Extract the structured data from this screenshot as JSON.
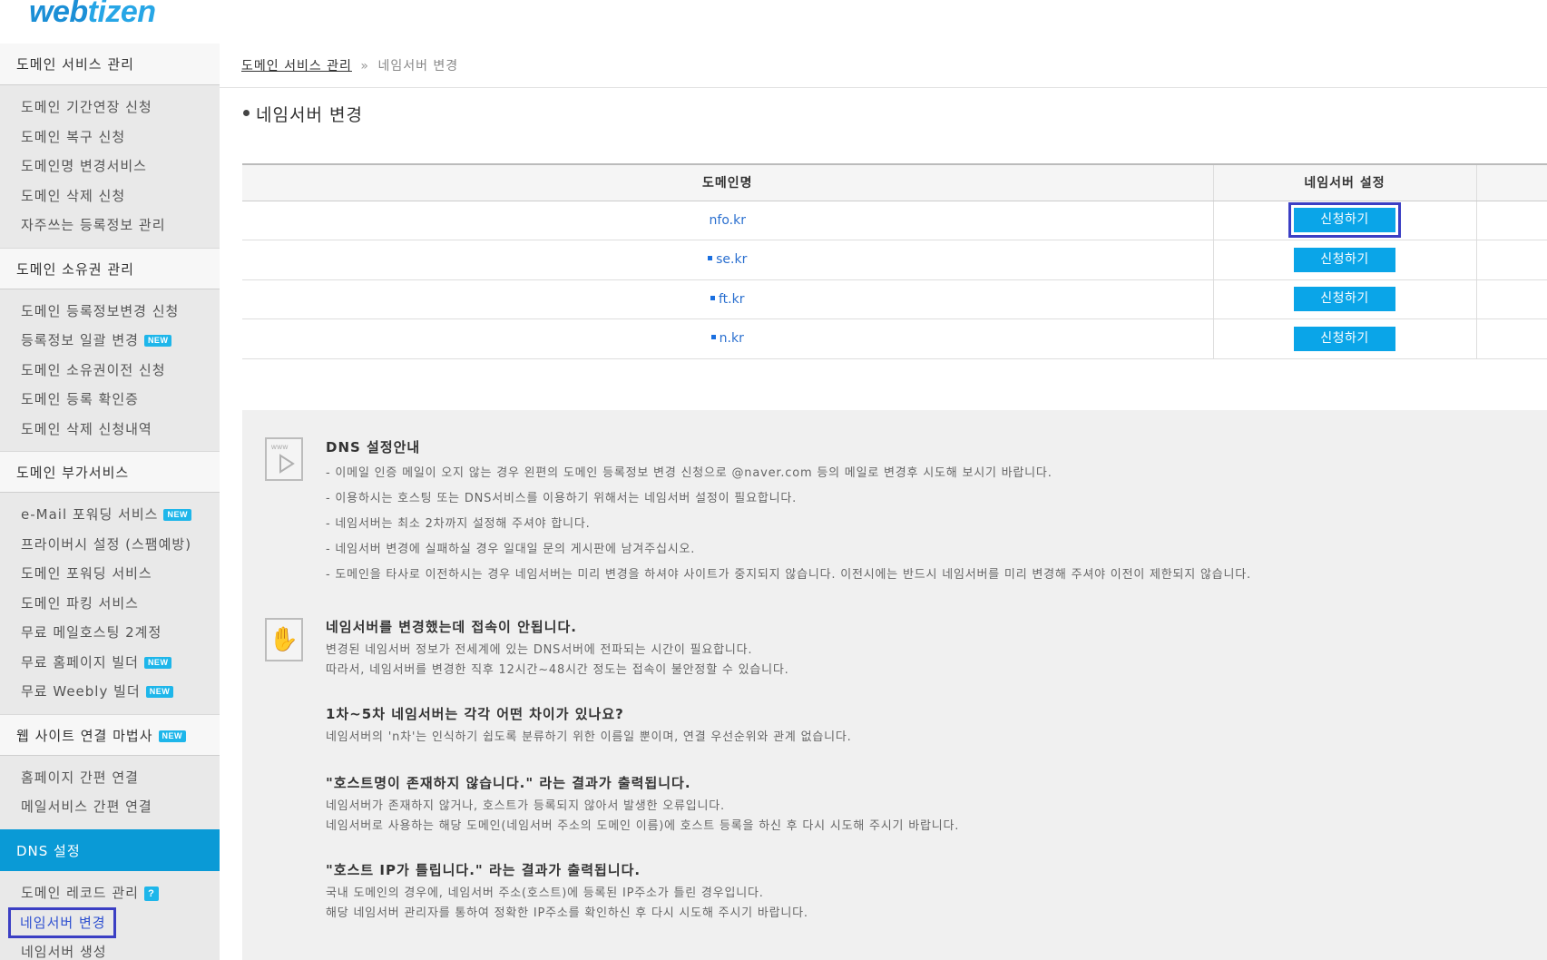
{
  "logo": {
    "part1": "web",
    "part2": "tizen"
  },
  "sidebar": {
    "sections": [
      {
        "title": "도메인 서비스 관리",
        "items": [
          {
            "label": "도메인 기간연장 신청"
          },
          {
            "label": "도메인 복구 신청"
          },
          {
            "label": "도메인명 변경서비스"
          },
          {
            "label": "도메인 삭제 신청"
          },
          {
            "label": "자주쓰는 등록정보 관리"
          }
        ]
      },
      {
        "title": "도메인 소유권 관리",
        "items": [
          {
            "label": "도메인 등록정보변경 신청"
          },
          {
            "label": "등록정보 일괄 변경",
            "badge": "NEW"
          },
          {
            "label": "도메인 소유권이전 신청"
          },
          {
            "label": "도메인 등록 확인증"
          },
          {
            "label": "도메인 삭제 신청내역"
          }
        ]
      },
      {
        "title": "도메인 부가서비스",
        "items": [
          {
            "label": "e-Mail 포워딩 서비스",
            "badge": "NEW"
          },
          {
            "label": "프라이버시 설정 (스팸예방)"
          },
          {
            "label": "도메인 포워딩 서비스"
          },
          {
            "label": "도메인 파킹 서비스"
          },
          {
            "label": "무료 메일호스팅 2계정"
          },
          {
            "label": "무료 홈페이지 빌더",
            "badge": "NEW"
          },
          {
            "label": "무료 Weebly 빌더",
            "badge": "NEW"
          }
        ]
      },
      {
        "title": "웹 사이트 연결 마법사",
        "badge": "NEW",
        "items": [
          {
            "label": "홈페이지 간편 연결"
          },
          {
            "label": "메일서비스 간편 연결"
          }
        ]
      },
      {
        "title": "DNS 설정",
        "items": [
          {
            "label": "도메인 레코드 관리",
            "badge": "?"
          },
          {
            "label": "네임서버 변경"
          },
          {
            "label": "네임서버 생성"
          }
        ]
      }
    ]
  },
  "breadcrumb": {
    "parent": "도메인 서비스 관리",
    "separator": "»",
    "current": "네임서버 변경"
  },
  "page_title": "네임서버 변경",
  "table": {
    "headers": {
      "domain": "도메인명",
      "nameserver": "네임서버 설정"
    },
    "rows": [
      {
        "domain": "nfo.kr",
        "button": "신청하기"
      },
      {
        "domain": "se.kr",
        "button": "신청하기"
      },
      {
        "domain": "ft.kr",
        "button": "신청하기"
      },
      {
        "domain": "n.kr",
        "button": "신청하기"
      }
    ]
  },
  "guide": {
    "dns": {
      "title": "DNS 설정안내",
      "lines": [
        "- 이메일 인증 메일이 오지 않는 경우 왼편의 도메인 등록정보 변경 신청으로 @naver.com 등의 메일로 변경후 시도해 보시기 바랍니다.",
        "- 이용하시는 호스팅 또는 DNS서비스를 이용하기 위해서는 네임서버 설정이 필요합니다.",
        "- 네임서버는 최소 2차까지 설정해 주셔야 합니다.",
        "- 네임서버 변경에 실패하실 경우 일대일 문의 게시판에 남겨주십시오.",
        "- 도메인을 타사로 이전하시는 경우 네임서버는 미리 변경을 하셔야 사이트가 중지되지 않습니다. 이전시에는 반드시 네임서버를 미리 변경해 주셔야 이전이 제한되지 않습니다."
      ]
    },
    "faq": [
      {
        "title": "네임서버를 변경했는데 접속이 안됩니다.",
        "lines": [
          "변경된 네임서버 정보가 전세계에 있는 DNS서버에 전파되는 시간이 필요합니다.",
          "따라서, 네임서버를 변경한 직후 12시간~48시간 정도는 접속이 불안정할 수 있습니다."
        ]
      },
      {
        "title": "1차~5차 네임서버는 각각 어떤 차이가 있나요?",
        "lines": [
          "네임서버의 'n차'는 인식하기 쉽도록 분류하기 위한 이름일 뿐이며, 연결 우선순위와 관계 없습니다."
        ]
      },
      {
        "title": "\"호스트명이 존재하지 않습니다.\" 라는 결과가 출력됩니다.",
        "lines": [
          "네임서버가 존재하지 않거나, 호스트가 등록되지 않아서 발생한 오류입니다.",
          "네임서버로 사용하는 해당 도메인(네임서버 주소의 도메인 이름)에 호스트 등록을 하신 후 다시 시도해 주시기 바랍니다."
        ]
      },
      {
        "title": "\"호스트 IP가 틀립니다.\" 라는 결과가 출력됩니다.",
        "lines": [
          "국내 도메인의 경우에, 네임서버 주소(호스트)에 등록된 IP주소가 틀린 경우입니다.",
          "해당 네임서버 관리자를 통하여 정확한 IP주소를 확인하신 후 다시 시도해 주시기 바랍니다."
        ]
      }
    ]
  },
  "colors": {
    "accent": "#0aa5e8",
    "highlight": "#3b3fc4",
    "active_section": "#0a9ad6"
  }
}
